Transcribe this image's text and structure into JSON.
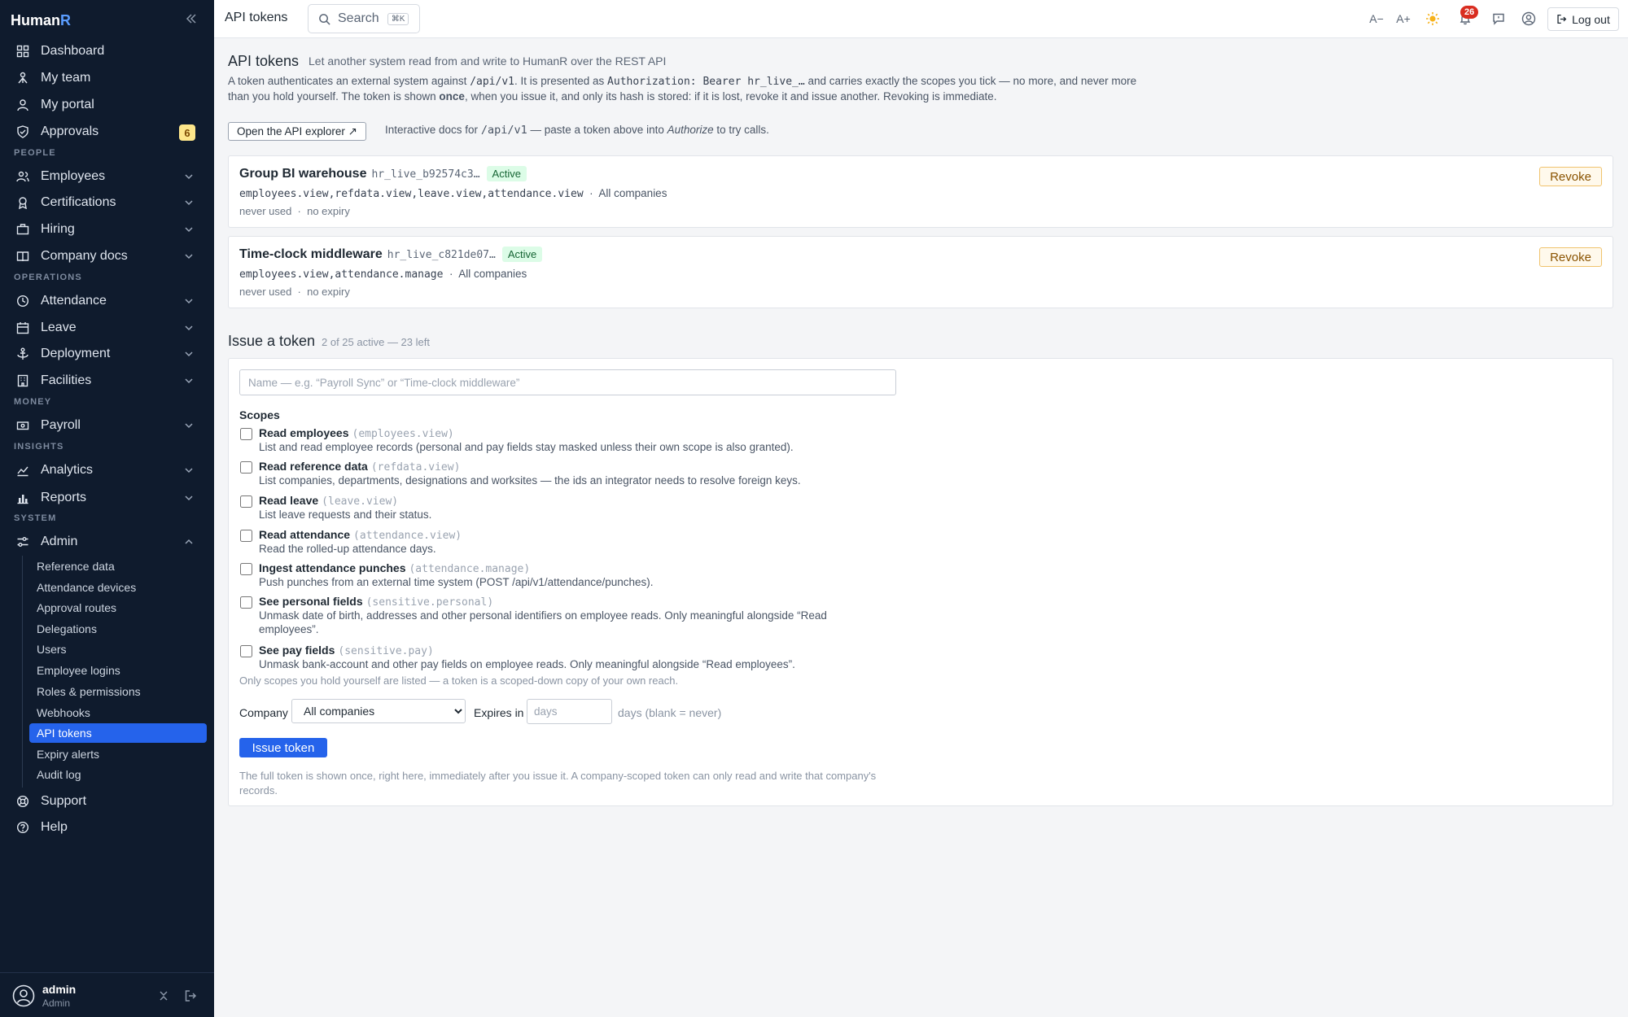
{
  "app": {
    "brand_main": "Human",
    "brand_accent": "R",
    "accent": "#2563eb"
  },
  "sidebar": {
    "items": [
      {
        "label": "Dashboard"
      },
      {
        "label": "My team"
      },
      {
        "label": "My portal"
      },
      {
        "label": "Approvals",
        "badge": "6"
      },
      {
        "label": "Employees"
      },
      {
        "label": "Certifications"
      },
      {
        "label": "Hiring"
      },
      {
        "label": "Company docs"
      },
      {
        "label": "Attendance"
      },
      {
        "label": "Leave"
      },
      {
        "label": "Deployment"
      },
      {
        "label": "Facilities"
      },
      {
        "label": "Payroll"
      },
      {
        "label": "Analytics"
      },
      {
        "label": "Reports"
      },
      {
        "label": "Admin"
      },
      {
        "label": "Support"
      },
      {
        "label": "Help"
      }
    ],
    "sections": [
      "PEOPLE",
      "OPERATIONS",
      "MONEY",
      "INSIGHTS",
      "SYSTEM"
    ],
    "admin_sub": [
      "Reference data",
      "Attendance devices",
      "Approval routes",
      "Delegations",
      "Users",
      "Employee logins",
      "Roles & permissions",
      "Webhooks",
      "API tokens",
      "Expiry alerts",
      "Audit log"
    ],
    "user": {
      "name": "admin",
      "role": "Admin"
    }
  },
  "topbar": {
    "title": "API tokens",
    "search_label": "Search",
    "search_kbd": "⌘K",
    "font_dec": "A−",
    "font_inc": "A+",
    "notif_count": "26",
    "logout": "Log out"
  },
  "page": {
    "title": "API tokens",
    "subtitle": "Let another system read from and write to HumanR over the REST API",
    "intro_1": "A token authenticates an external system against ",
    "intro_path": "/api/v1",
    "intro_2": ". It is presented as ",
    "intro_auth": "Authorization: Bearer hr_live_…",
    "intro_3": " and carries exactly the scopes you tick — no more, and never more than you hold yourself. The token is shown ",
    "intro_once": "once",
    "intro_4": ", when you issue it, and only its hash is stored: if it is lost, revoke it and issue another. Revoking is immediate.",
    "explorer_button": "Open the API explorer ↗",
    "explorer_note_1": "Interactive docs for ",
    "explorer_note_path": "/api/v1",
    "explorer_note_2": " — paste a token above into ",
    "explorer_note_auth": "Authorize",
    "explorer_note_3": " to try calls."
  },
  "tokens": [
    {
      "name": "Group BI warehouse",
      "token": "hr_live_b92574c3…",
      "status": "Active",
      "scopes": "employees.view,refdata.view,leave.view,attendance.view",
      "company": "All companies",
      "usage": "never used",
      "expiry": "no expiry",
      "revoke": "Revoke"
    },
    {
      "name": "Time-clock middleware",
      "token": "hr_live_c821de07…",
      "status": "Active",
      "scopes": "employees.view,attendance.manage",
      "company": "All companies",
      "usage": "never used",
      "expiry": "no expiry",
      "revoke": "Revoke"
    }
  ],
  "issue": {
    "title": "Issue a token",
    "count": "2 of 25 active — 23 left",
    "name_placeholder": "Name — e.g. “Payroll Sync” or “Time-clock middleware”",
    "scopes_heading": "Scopes",
    "scopes": [
      {
        "label": "Read employees",
        "code": "(employees.view)",
        "desc": "List and read employee records (personal and pay fields stay masked unless their own scope is also granted)."
      },
      {
        "label": "Read reference data",
        "code": "(refdata.view)",
        "desc": "List companies, departments, designations and worksites — the ids an integrator needs to resolve foreign keys."
      },
      {
        "label": "Read leave",
        "code": "(leave.view)",
        "desc": "List leave requests and their status."
      },
      {
        "label": "Read attendance",
        "code": "(attendance.view)",
        "desc": "Read the rolled-up attendance days."
      },
      {
        "label": "Ingest attendance punches",
        "code": "(attendance.manage)",
        "desc": "Push punches from an external time system (POST /api/v1/attendance/punches)."
      },
      {
        "label": "See personal fields",
        "code": "(sensitive.personal)",
        "desc": "Unmask date of birth, addresses and other personal identifiers on employee reads. Only meaningful alongside “Read employees”."
      },
      {
        "label": "See pay fields",
        "code": "(sensitive.pay)",
        "desc": "Unmask bank-account and other pay fields on employee reads. Only meaningful alongside “Read employees”."
      }
    ],
    "only_note": "Only scopes you hold yourself are listed — a token is a scoped-down copy of your own reach.",
    "company_label": "Company",
    "company_value": "All companies",
    "expires_label": "Expires in",
    "expires_placeholder": "days",
    "expires_note": "days (blank = never)",
    "submit": "Issue token",
    "final_note": "The full token is shown once, right here, immediately after you issue it. A company-scoped token can only read and write that company's records."
  }
}
